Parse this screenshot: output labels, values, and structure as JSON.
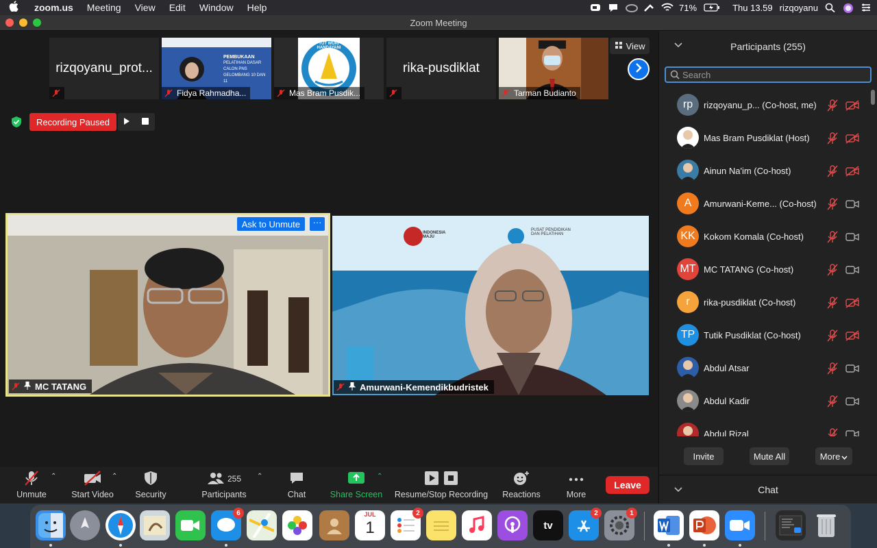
{
  "menubar": {
    "app": "zoom.us",
    "items": [
      "Meeting",
      "View",
      "Edit",
      "Window",
      "Help"
    ],
    "battery": "71%",
    "clock": "Thu 13.59",
    "user": "rizqoyanu"
  },
  "window": {
    "title": "Zoom Meeting"
  },
  "thumbnails": [
    {
      "name": "rizqoyanu_prot...",
      "big_name": "rizqoyanu_prot...",
      "video": false
    },
    {
      "name": "Fidya Rahmadha...",
      "video": true
    },
    {
      "name": "Mas Bram Pusdik...",
      "video": true
    },
    {
      "name": "",
      "big_name": "rika-pusdiklat",
      "video": false
    },
    {
      "name": "Tarman Budianto",
      "video": true
    }
  ],
  "slide_thumb": {
    "heading": "PEMBUKAAN",
    "line1": "PELATIHAN DASAR",
    "line2": "CALON PNS",
    "line3": "GELOMBANG 10 DAN 11"
  },
  "logo_motto": "TUT WURI HANDAYANI",
  "view_button": "View",
  "recording": {
    "status": "Recording Paused"
  },
  "tiles": {
    "left": {
      "name": "MC TATANG",
      "ask_unmute": "Ask to Unmute",
      "more": "···"
    },
    "right": {
      "name": "Amurwani-Kemendikbudristek",
      "banner_left": "INDONESIA MAJU",
      "banner_right": "PUSAT PENDIDIKAN DAN PELATIHAN"
    }
  },
  "toolbar": {
    "unmute": "Unmute",
    "start_video": "Start Video",
    "security": "Security",
    "participants": "Participants",
    "participant_count": "255",
    "chat": "Chat",
    "share_screen": "Share Screen",
    "recording": "Resume/Stop Recording",
    "reactions": "Reactions",
    "more": "More",
    "leave": "Leave"
  },
  "panel": {
    "title": "Participants (255)",
    "search_placeholder": "Search",
    "participants": [
      {
        "initials": "rp",
        "color": "#5a6d7e",
        "name": "rizqoyanu_p...  (Co-host, me)",
        "cam_off": true
      },
      {
        "initials": "",
        "color": "#ffffff",
        "name": "Mas Bram Pusdiklat (Host)",
        "cam_off": true
      },
      {
        "initials": "",
        "color": "#3a7ca5",
        "name": "Ainun Na'im (Co-host)",
        "cam_off": true
      },
      {
        "initials": "A",
        "color": "#f07a1e",
        "name": "Amurwani-Keme...  (Co-host)",
        "cam_off": false
      },
      {
        "initials": "KK",
        "color": "#f07a1e",
        "name": "Kokom Komala (Co-host)",
        "cam_off": false
      },
      {
        "initials": "MT",
        "color": "#e0443b",
        "name": "MC TATANG (Co-host)",
        "cam_off": false
      },
      {
        "initials": "r",
        "color": "#f5a33a",
        "name": "rika-pusdiklat (Co-host)",
        "cam_off": true
      },
      {
        "initials": "TP",
        "color": "#1e8fe1",
        "name": "Tutik Pusdiklat (Co-host)",
        "cam_off": true
      },
      {
        "initials": "",
        "color": "#2d5fa8",
        "name": "Abdul Atsar",
        "cam_off": false
      },
      {
        "initials": "",
        "color": "#8a8a8a",
        "name": "Abdul Kadir",
        "cam_off": false
      },
      {
        "initials": "",
        "color": "#b02a2a",
        "name": "Abdul Rizal",
        "cam_off": false
      }
    ],
    "invite": "Invite",
    "mute_all": "Mute All",
    "more": "More",
    "chat_title": "Chat"
  },
  "dock": {
    "calendar_month": "JUL",
    "calendar_day": "1",
    "appletv_label": "tv",
    "badges": {
      "messages": "6",
      "reminders": "2",
      "appstore": "2",
      "sysprefs": "1"
    }
  }
}
